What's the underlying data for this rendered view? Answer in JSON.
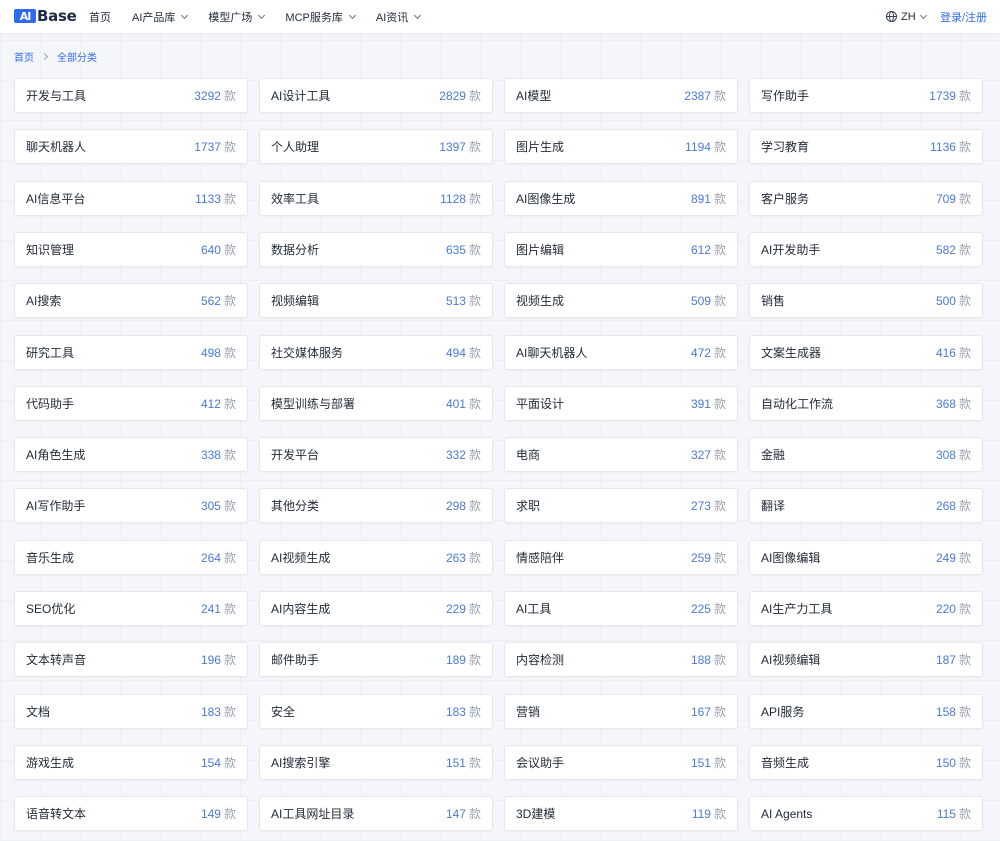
{
  "header": {
    "logo": {
      "mark": "AI",
      "text": "Base"
    },
    "nav": [
      {
        "label": "首页",
        "dropdown": false
      },
      {
        "label": "AI产品库",
        "dropdown": true
      },
      {
        "label": "模型广场",
        "dropdown": true
      },
      {
        "label": "MCP服务库",
        "dropdown": true
      },
      {
        "label": "AI资讯",
        "dropdown": true
      }
    ],
    "language": "ZH",
    "login": "登录/注册"
  },
  "breadcrumb": [
    "首页",
    "全部分类"
  ],
  "unit": "款",
  "categories": [
    {
      "name": "开发与工具",
      "count": "3292"
    },
    {
      "name": "AI设计工具",
      "count": "2829"
    },
    {
      "name": "AI模型",
      "count": "2387"
    },
    {
      "name": "写作助手",
      "count": "1739"
    },
    {
      "name": "聊天机器人",
      "count": "1737"
    },
    {
      "name": "个人助理",
      "count": "1397"
    },
    {
      "name": "图片生成",
      "count": "1194"
    },
    {
      "name": "学习教育",
      "count": "1136"
    },
    {
      "name": "AI信息平台",
      "count": "1133"
    },
    {
      "name": "效率工具",
      "count": "1128"
    },
    {
      "name": "AI图像生成",
      "count": "891"
    },
    {
      "name": "客户服务",
      "count": "709"
    },
    {
      "name": "知识管理",
      "count": "640"
    },
    {
      "name": "数据分析",
      "count": "635"
    },
    {
      "name": "图片编辑",
      "count": "612"
    },
    {
      "name": "AI开发助手",
      "count": "582"
    },
    {
      "name": "AI搜索",
      "count": "562"
    },
    {
      "name": "视频编辑",
      "count": "513"
    },
    {
      "name": "视频生成",
      "count": "509"
    },
    {
      "name": "销售",
      "count": "500"
    },
    {
      "name": "研究工具",
      "count": "498"
    },
    {
      "name": "社交媒体服务",
      "count": "494"
    },
    {
      "name": "AI聊天机器人",
      "count": "472"
    },
    {
      "name": "文案生成器",
      "count": "416"
    },
    {
      "name": "代码助手",
      "count": "412"
    },
    {
      "name": "模型训练与部署",
      "count": "401"
    },
    {
      "name": "平面设计",
      "count": "391"
    },
    {
      "name": "自动化工作流",
      "count": "368"
    },
    {
      "name": "AI角色生成",
      "count": "338"
    },
    {
      "name": "开发平台",
      "count": "332"
    },
    {
      "name": "电商",
      "count": "327"
    },
    {
      "name": "金融",
      "count": "308"
    },
    {
      "name": "AI写作助手",
      "count": "305"
    },
    {
      "name": "其他分类",
      "count": "298"
    },
    {
      "name": "求职",
      "count": "273"
    },
    {
      "name": "翻译",
      "count": "268"
    },
    {
      "name": "音乐生成",
      "count": "264"
    },
    {
      "name": "AI视频生成",
      "count": "263"
    },
    {
      "name": "情感陪伴",
      "count": "259"
    },
    {
      "name": "AI图像编辑",
      "count": "249"
    },
    {
      "name": "SEO优化",
      "count": "241"
    },
    {
      "name": "AI内容生成",
      "count": "229"
    },
    {
      "name": "AI工具",
      "count": "225"
    },
    {
      "name": "AI生产力工具",
      "count": "220"
    },
    {
      "name": "文本转声音",
      "count": "196"
    },
    {
      "name": "邮件助手",
      "count": "189"
    },
    {
      "name": "内容检测",
      "count": "188"
    },
    {
      "name": "AI视频编辑",
      "count": "187"
    },
    {
      "name": "文档",
      "count": "183"
    },
    {
      "name": "安全",
      "count": "183"
    },
    {
      "name": "营销",
      "count": "167"
    },
    {
      "name": "API服务",
      "count": "158"
    },
    {
      "name": "游戏生成",
      "count": "154"
    },
    {
      "name": "AI搜索引擎",
      "count": "151"
    },
    {
      "name": "会议助手",
      "count": "151"
    },
    {
      "name": "音频生成",
      "count": "150"
    },
    {
      "name": "语音转文本",
      "count": "149"
    },
    {
      "name": "AI工具网址目录",
      "count": "147"
    },
    {
      "name": "3D建模",
      "count": "119"
    },
    {
      "name": "AI Agents",
      "count": "115"
    }
  ]
}
